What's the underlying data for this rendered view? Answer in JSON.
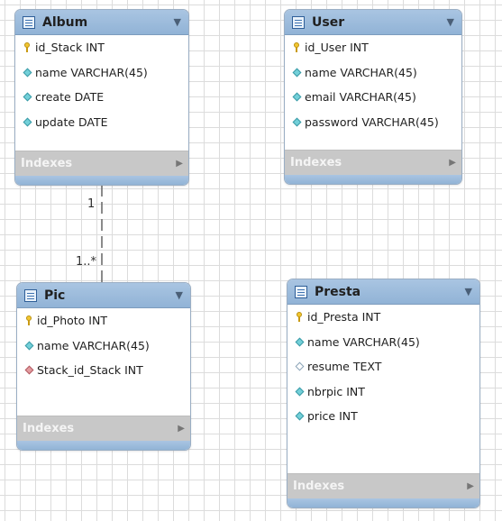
{
  "relationship": {
    "label_album_side": "1",
    "label_pic_side": "1..*"
  },
  "tables": {
    "album": {
      "name": "Album",
      "columns": [
        {
          "text": "id_Stack INT",
          "icon": "key-icon"
        },
        {
          "text": "name VARCHAR(45)",
          "icon": "column-icon"
        },
        {
          "text": "create DATE",
          "icon": "column-icon"
        },
        {
          "text": "update DATE",
          "icon": "column-icon"
        }
      ],
      "indexes_label": "Indexes"
    },
    "user": {
      "name": "User",
      "columns": [
        {
          "text": "id_User INT",
          "icon": "key-icon"
        },
        {
          "text": "name VARCHAR(45)",
          "icon": "column-icon"
        },
        {
          "text": "email VARCHAR(45)",
          "icon": "column-icon"
        },
        {
          "text": "password VARCHAR(45)",
          "icon": "column-icon"
        }
      ],
      "indexes_label": "Indexes"
    },
    "pic": {
      "name": "Pic",
      "columns": [
        {
          "text": "id_Photo INT",
          "icon": "key-icon"
        },
        {
          "text": "name VARCHAR(45)",
          "icon": "column-icon"
        },
        {
          "text": "Stack_id_Stack INT",
          "icon": "foreign-key-icon"
        }
      ],
      "indexes_label": "Indexes"
    },
    "presta": {
      "name": "Presta",
      "columns": [
        {
          "text": "id_Presta INT",
          "icon": "key-icon"
        },
        {
          "text": "name VARCHAR(45)",
          "icon": "column-icon"
        },
        {
          "text": "resume TEXT",
          "icon": "nullable-column-icon"
        },
        {
          "text": "nbrpic INT",
          "icon": "column-icon"
        },
        {
          "text": "price INT",
          "icon": "column-icon"
        }
      ],
      "indexes_label": "Indexes"
    }
  },
  "colors": {
    "header": "#a3c1e0",
    "indexes_bar": "#c8c8c8",
    "column_icon": "#73d0d9",
    "foreign_key_icon": "#e39ca0",
    "key_icon": "#f2c631"
  }
}
